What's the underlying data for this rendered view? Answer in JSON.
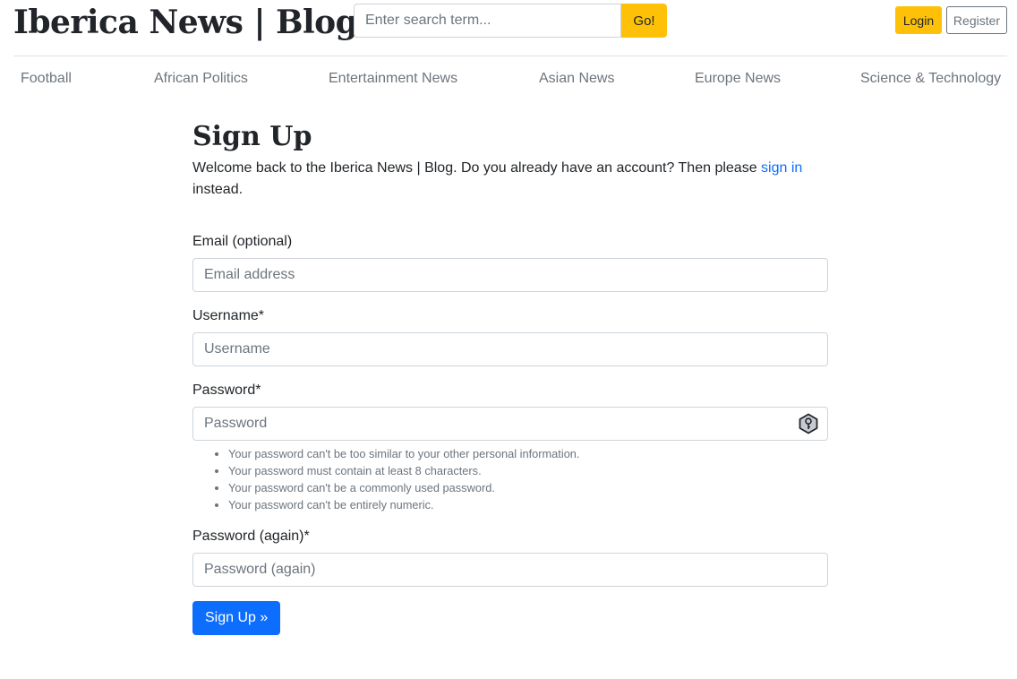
{
  "header": {
    "brand": "Iberica News | Blog",
    "search_placeholder": "Enter search term...",
    "search_button": "Go!",
    "login_label": "Login",
    "register_label": "Register"
  },
  "nav": {
    "items": [
      "Football",
      "African Politics",
      "Entertainment News",
      "Asian News",
      "Europe News",
      "Science & Technology"
    ]
  },
  "signup": {
    "title": "Sign Up",
    "intro_text": "Welcome back to the Iberica News | Blog. Do you already have an account? Then please ",
    "intro_link": "sign in",
    "intro_suffix": "instead.",
    "email_label": "Email (optional)",
    "email_placeholder": "Email address",
    "username_label": "Username*",
    "username_placeholder": "Username",
    "password_label": "Password*",
    "password_placeholder": "Password",
    "password_help": [
      "Your password can't be too similar to your other personal information.",
      "Your password must contain at least 8 characters.",
      "Your password can't be a commonly used password.",
      "Your password can't be entirely numeric."
    ],
    "password2_label": "Password (again)*",
    "password2_placeholder": "Password (again)",
    "submit_label": "Sign Up »"
  },
  "colors": {
    "accent": "#ffc107",
    "primary": "#0d6efd",
    "muted": "#6c757d"
  }
}
